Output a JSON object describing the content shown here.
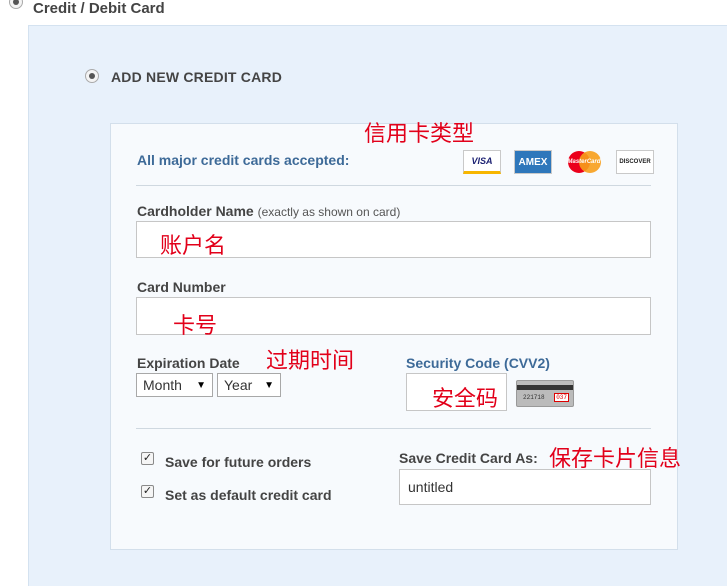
{
  "payment_method": {
    "label": "Credit / Debit Card"
  },
  "add_new": {
    "label": "ADD NEW CREDIT CARD"
  },
  "accepted": {
    "label": "All major credit cards accepted:",
    "logos": [
      "VISA",
      "AMEX",
      "MasterCard",
      "DISCOVER"
    ]
  },
  "cardholder": {
    "label": "Cardholder Name",
    "hint": "(exactly as shown on card)",
    "value": ""
  },
  "card_number": {
    "label": "Card Number",
    "value": ""
  },
  "expiration": {
    "label": "Expiration Date",
    "month": "Month",
    "year": "Year"
  },
  "cvv": {
    "label": "Security Code (CVV2)",
    "card_number_text": "221718",
    "card_code_text": "037"
  },
  "save_future": {
    "label": "Save for future orders",
    "checked": true
  },
  "set_default": {
    "label": "Set as default credit card",
    "checked": true
  },
  "save_as": {
    "label": "Save Credit Card As:",
    "value": "untitled"
  },
  "annotations": {
    "card_types": "信用卡类型",
    "account_name": "账户名",
    "card_number": "卡号",
    "expiration": "过期时间",
    "security_code": "安全码",
    "save_card": "保存卡片信息"
  },
  "colors": {
    "panel_bg": "#e8f1fb",
    "link_blue": "#3d6a98",
    "annotation_red": "#e2001a"
  }
}
